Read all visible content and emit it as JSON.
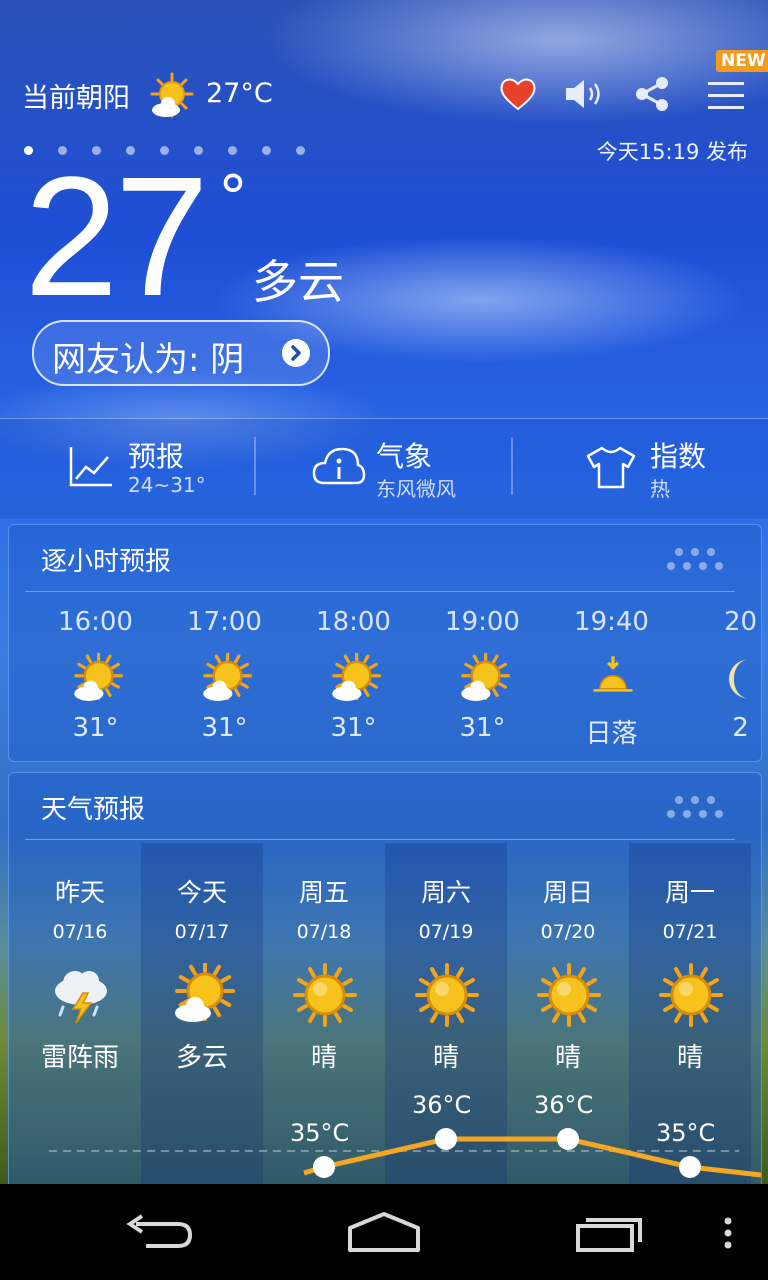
{
  "header": {
    "city": "当前朝阳",
    "current_icon": "partly-cloudy-icon",
    "current_temp": "27°C",
    "new_badge": "NEW",
    "page_count": 9,
    "active_page": 0,
    "publish_time": "今天15:19 发布"
  },
  "current": {
    "temperature": "27",
    "degree": "°",
    "condition": "多云",
    "netizen_opinion": "网友认为: 阴"
  },
  "strip": [
    {
      "title": "预报",
      "sub": "24~31°",
      "icon": "trend-chart-icon"
    },
    {
      "title": "气象",
      "sub": "东风微风",
      "icon": "cloud-info-icon"
    },
    {
      "title": "指数",
      "sub": "热",
      "icon": "tshirt-icon"
    }
  ],
  "hourly": {
    "title": "逐小时预报",
    "items": [
      {
        "time": "16:00",
        "icon": "partly-cloudy-icon",
        "temp": "31°"
      },
      {
        "time": "17:00",
        "icon": "partly-cloudy-icon",
        "temp": "31°"
      },
      {
        "time": "18:00",
        "icon": "partly-cloudy-icon",
        "temp": "31°"
      },
      {
        "time": "19:00",
        "icon": "partly-cloudy-icon",
        "temp": "31°"
      },
      {
        "time": "19:40",
        "icon": "sunset-icon",
        "temp": "日落"
      },
      {
        "time": "20",
        "icon": "moon-icon",
        "temp": "2"
      }
    ]
  },
  "daily": {
    "title": "天气预报",
    "items": [
      {
        "day": "昨天",
        "date": "07/16",
        "icon": "thunderstorm-icon",
        "cond": "雷阵雨",
        "high": ""
      },
      {
        "day": "今天",
        "date": "07/17",
        "icon": "partly-cloudy-icon",
        "cond": "多云",
        "high": ""
      },
      {
        "day": "周五",
        "date": "07/18",
        "icon": "sunny-icon",
        "cond": "晴",
        "high": "35°C"
      },
      {
        "day": "周六",
        "date": "07/19",
        "icon": "sunny-icon",
        "cond": "晴",
        "high": "36°C"
      },
      {
        "day": "周日",
        "date": "07/20",
        "icon": "sunny-icon",
        "cond": "晴",
        "high": "36°C"
      },
      {
        "day": "周一",
        "date": "07/21",
        "icon": "sunny-icon",
        "cond": "晴",
        "high": "35°C"
      }
    ],
    "high_line_color": "#f5a623"
  },
  "colors": {
    "heart": "#e8402a",
    "badge": "#f29b1c",
    "sun": "#f7c21b"
  }
}
